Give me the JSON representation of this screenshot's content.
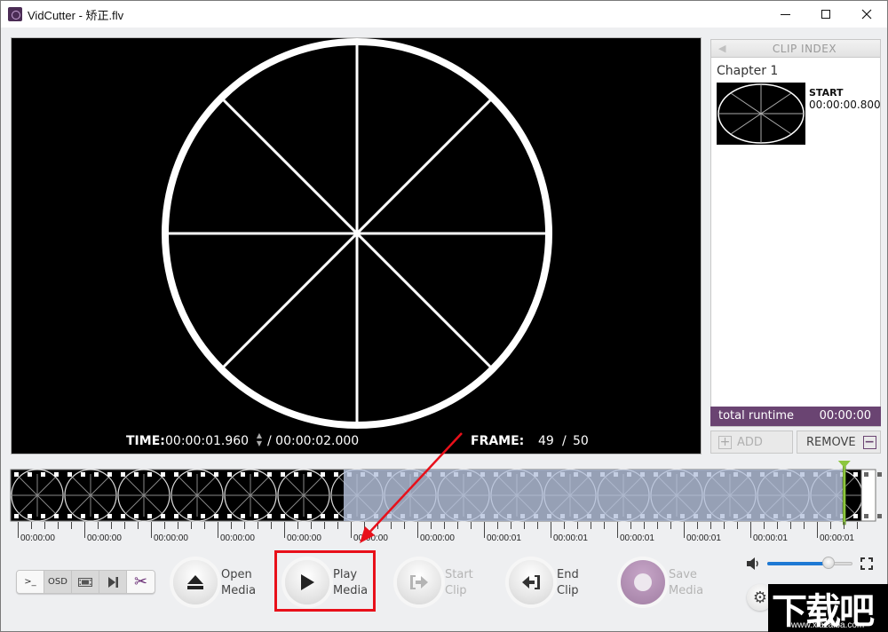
{
  "window": {
    "title": "VidCutter - 矫正.flv",
    "controls": {
      "minimize": "minimize",
      "maximize": "maximize",
      "close": "close"
    }
  },
  "player": {
    "time_label": "TIME:",
    "current_time": "00:00:01.960",
    "total_time": "/ 00:00:02.000",
    "frame_label": "FRAME:",
    "current_frame": "49",
    "frame_separator": "/",
    "total_frames": "50"
  },
  "clip_index": {
    "title": "CLIP INDEX",
    "collapse_icon": "triangle-left",
    "chapters": [
      {
        "name": "Chapter 1",
        "start_label": "START",
        "start_time": "00:00:00.800"
      }
    ],
    "total_runtime_label": "total runtime",
    "total_runtime": "00:00:00",
    "add_label": "ADD",
    "remove_label": "REMOVE"
  },
  "timeline": {
    "tick_labels": [
      "00:00:00",
      "00:00:00",
      "00:00:00",
      "00:00:00",
      "00:00:00",
      "00:00:00",
      "00:00:00",
      "00:00:01",
      "00:00:01",
      "00:00:01",
      "00:00:01",
      "00:00:01",
      "00:00:01"
    ],
    "selected_fraction_start": 0.4,
    "playhead_fraction": 0.98
  },
  "toolbar": {
    "toggles": [
      {
        "name": "console",
        "label": ">_",
        "active": false
      },
      {
        "name": "osd",
        "label": "OSD",
        "active": true
      },
      {
        "name": "thumbnails",
        "label": "▣",
        "active": true
      },
      {
        "name": "chapters",
        "label": "▶|",
        "active": true
      },
      {
        "name": "smartcut",
        "label": "✂",
        "active": false
      }
    ],
    "open_media": {
      "line1": "Open",
      "line2": "Media"
    },
    "play_media": {
      "line1": "Play",
      "line2": "Media"
    },
    "start_clip": {
      "line1": "Start",
      "line2": "Clip"
    },
    "end_clip": {
      "line1": "End",
      "line2": "Clip"
    },
    "save_media": {
      "line1": "Save",
      "line2": "Media"
    },
    "volume_percent": 72
  },
  "watermark": {
    "main": "下载吧",
    "url": "www.xiazaiba.com"
  },
  "colors": {
    "accent_purple": "#6a4472",
    "playhead_green": "#8cc63f",
    "volume_blue": "#1e79d4",
    "highlight_red": "#e8101a"
  }
}
